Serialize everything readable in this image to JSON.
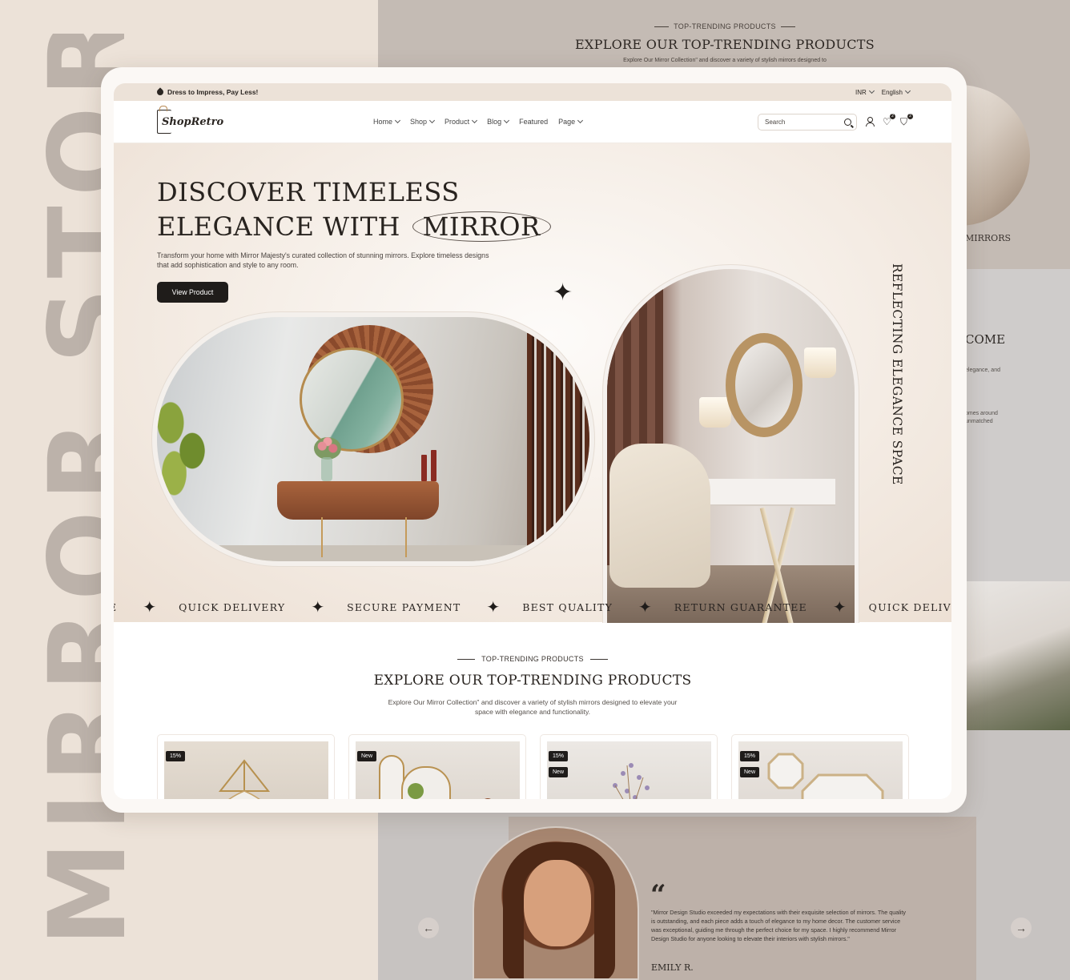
{
  "showcase": {
    "vertical_title": "MIRROR STORE",
    "bg_trend_kicker": "TOP-TRENDING PRODUCTS",
    "bg_trend_title": "EXPLORE OUR TOP-TRENDING PRODUCTS",
    "bg_trend_sub": "Explore Our Mirror Collection\" and discover a variety of stylish mirrors designed to",
    "bg_mirrors_label": "MIRRORS",
    "bg_welcome": "COME",
    "bg_welcome_p1": "elegance, and",
    "bg_welcome_p2": "omes around unmatched",
    "testimonial": {
      "quote_mark": "“",
      "text": "\"Mirror Design Studio exceeded my expectations with their exquisite selection of mirrors. The quality is outstanding, and each piece adds a touch of elegance to my home decor. The customer service was exceptional, guiding me through the perfect choice for my space. I highly recommend Mirror Design Studio for anyone looking to elevate their interiors with stylish mirrors.\"",
      "author": "EMILY R.",
      "prev": "←",
      "next": "→"
    }
  },
  "topbar": {
    "promo": "Dress to Impress, Pay Less!",
    "currency": "INR",
    "language": "English"
  },
  "nav": {
    "logo": "ShopRetro",
    "menu": [
      "Home",
      "Shop",
      "Product",
      "Blog",
      "Featured",
      "Page"
    ],
    "search_placeholder": "Search",
    "wishlist_count": "2",
    "cart_count": "2"
  },
  "hero": {
    "title_line1": "DISCOVER TIMELESS",
    "title_line2_prefix": "ELEGANCE WITH",
    "title_highlight": "MIRROR",
    "description": "Transform your home with Mirror Majesty's curated collection of stunning mirrors. Explore timeless designs that add sophistication and style to any room.",
    "cta": "View Product",
    "vertical_tag": "REFLECTING ELEGANCE SPACE"
  },
  "marquee": {
    "lead_fragment": "E",
    "items": [
      "QUICK DELIVERY",
      "SECURE PAYMENT",
      "BEST QUALITY",
      "RETURN GUARANTEE"
    ],
    "tail_fragment": "QUICK DELIVE"
  },
  "trending": {
    "kicker": "TOP-TRENDING PRODUCTS",
    "title": "EXPLORE OUR TOP-TRENDING PRODUCTS",
    "subtitle": "Explore Our Mirror Collection\" and discover a variety of stylish mirrors designed to elevate your space with elegance and functionality.",
    "cards": [
      {
        "badges": [
          "15%"
        ]
      },
      {
        "badges": [
          "New"
        ]
      },
      {
        "badges": [
          "15%",
          "New"
        ]
      },
      {
        "badges": [
          "15%",
          "New"
        ]
      }
    ]
  }
}
